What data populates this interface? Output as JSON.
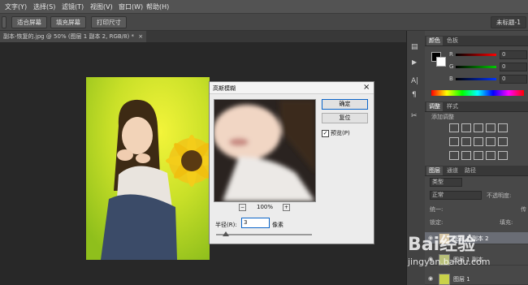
{
  "menubar": {
    "items": [
      "文字(Y)",
      "选择(S)",
      "滤镜(T)",
      "视图(V)",
      "窗口(W)",
      "帮助(H)"
    ]
  },
  "options": {
    "btn_fit": "适合屏幕",
    "btn_fill": "填充屏幕",
    "btn_print": "打印尺寸",
    "workspace": "未标题-1"
  },
  "document_tab": {
    "label": "副本-恢复的.jpg @ 50% (图层 1 副本 2, RGB/8) *",
    "close": "×"
  },
  "dialog": {
    "title": "高斯模糊",
    "close": "×",
    "ok": "确定",
    "reset": "复位",
    "preview_label": "预览(P)",
    "preview_checked": true,
    "zoom": "100%",
    "zoom_out": "−",
    "zoom_in": "+",
    "radius_label": "半径(R):",
    "radius_value": "3",
    "radius_unit": "像素",
    "radius_fraction": 0.1
  },
  "color_panel": {
    "tabs": [
      "颜色",
      "色板"
    ],
    "channels": [
      {
        "label": "R",
        "value": "0",
        "color": "#ff0000"
      },
      {
        "label": "G",
        "value": "0",
        "color": "#00cc00"
      },
      {
        "label": "B",
        "value": "0",
        "color": "#0033ff"
      }
    ]
  },
  "adjust_panel": {
    "tabs": [
      "调整",
      "样式"
    ],
    "add_label": "添加调整"
  },
  "layers_panel": {
    "tabs": [
      "图层",
      "通道",
      "路径"
    ],
    "kind": "类型",
    "blend": "正常",
    "opacity_label": "不透明度:",
    "lock_label": "锁定:",
    "unify_label": "统一:",
    "propagate_label": "传",
    "fill_label": "填充:",
    "layers": [
      {
        "name": "图层 1 副本 2",
        "active": true
      },
      {
        "name": "图层 1 副本",
        "active": false
      },
      {
        "name": "图层 1",
        "active": false
      }
    ]
  },
  "watermark": {
    "title": "Bai经验",
    "url": "jingyan.baidu.com"
  },
  "colors": {
    "accent": "#0a64c8",
    "ui_dark": "#282828",
    "ui_panel": "#484848"
  }
}
